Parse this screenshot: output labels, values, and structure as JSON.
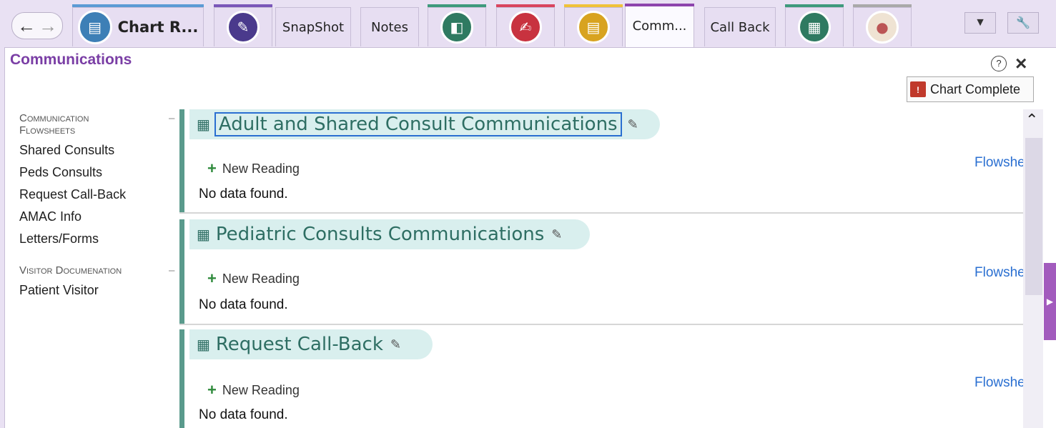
{
  "tabs": {
    "chart_review": "Chart R...",
    "snapshot": "SnapShot",
    "notes": "Notes",
    "communications": "Comm...",
    "call_back": "Call Back"
  },
  "colors": {
    "accent_purple": "#7a3ea5",
    "section_teal": "#2e6e63",
    "link_blue": "#2a6fd1"
  },
  "panel": {
    "title": "Communications",
    "chart_complete_label": "Chart Complete"
  },
  "sidebar": {
    "section1_line1": "Communication",
    "section1_line2": "Flowsheets",
    "items1": [
      "Shared Consults",
      "Peds Consults",
      "Request Call-Back",
      "AMAC Info",
      "Letters/Forms"
    ],
    "section2": "Visitor Documenation",
    "items2": [
      "Patient Visitor"
    ]
  },
  "sections": [
    {
      "title": "Adult and Shared Consult Communications",
      "new_reading": "New Reading",
      "empty": "No data found.",
      "link": "Flowsheet"
    },
    {
      "title": "Pediatric Consults Communications",
      "new_reading": "New Reading",
      "empty": "No data found.",
      "link": "Flowsheet"
    },
    {
      "title": "Request Call-Back",
      "new_reading": "New Reading",
      "empty": "No data found.",
      "link": "Flowsheet"
    }
  ]
}
